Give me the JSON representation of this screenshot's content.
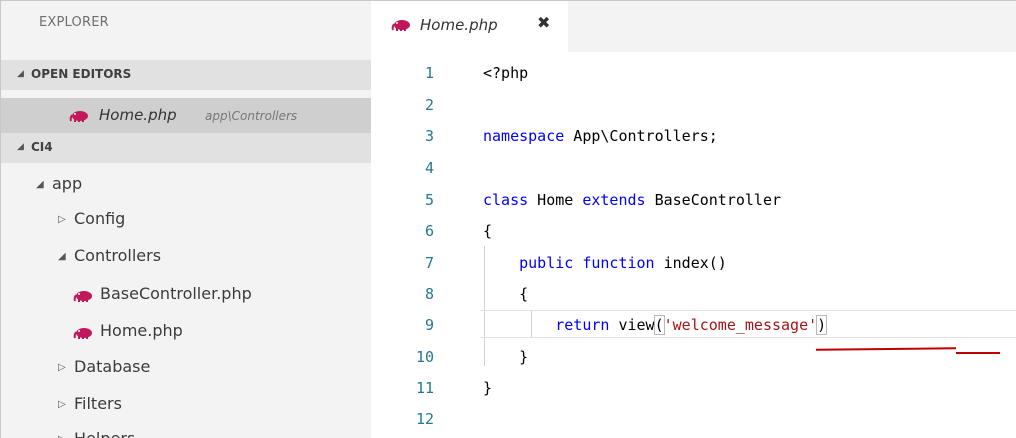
{
  "sidebar": {
    "title": "EXPLORER",
    "open_editors": {
      "label": "OPEN EDITORS",
      "files": [
        {
          "name": "Home.php",
          "path": "app\\Controllers",
          "icon": "php-elephant-icon"
        }
      ]
    },
    "project": {
      "label": "CI4",
      "tree": [
        {
          "label": "app",
          "expanded": true,
          "depth": 0
        },
        {
          "label": "Config",
          "expanded": false,
          "depth": 1
        },
        {
          "label": "Controllers",
          "expanded": true,
          "depth": 1
        },
        {
          "label": "BaseController.php",
          "depth": 2,
          "icon": "php-elephant-icon"
        },
        {
          "label": "Home.php",
          "depth": 2,
          "icon": "php-elephant-icon"
        },
        {
          "label": "Database",
          "expanded": false,
          "depth": 1
        },
        {
          "label": "Filters",
          "expanded": false,
          "depth": 1
        },
        {
          "label": "Helpers",
          "expanded": false,
          "depth": 1
        }
      ]
    }
  },
  "editor": {
    "tab": {
      "label": "Home.php",
      "close": "✖",
      "icon": "php-elephant-icon"
    },
    "lines": [
      {
        "n": "1",
        "code": "<?php"
      },
      {
        "n": "2",
        "code": ""
      },
      {
        "n": "3",
        "code": "namespace App\\Controllers;"
      },
      {
        "n": "4",
        "code": ""
      },
      {
        "n": "5",
        "code": "class Home extends BaseController"
      },
      {
        "n": "6",
        "code": "{"
      },
      {
        "n": "7",
        "code": "    public function index()"
      },
      {
        "n": "8",
        "code": "    {"
      },
      {
        "n": "9",
        "code": "        return view('welcome_message')"
      },
      {
        "n": "10",
        "code": "    }"
      },
      {
        "n": "11",
        "code": "}"
      },
      {
        "n": "12",
        "code": ""
      }
    ]
  },
  "colors": {
    "keyword": "#0000ff",
    "string": "#a31515",
    "line_number": "#237893",
    "error_squiggle": "#c00000",
    "php_icon": "#c2185b"
  }
}
